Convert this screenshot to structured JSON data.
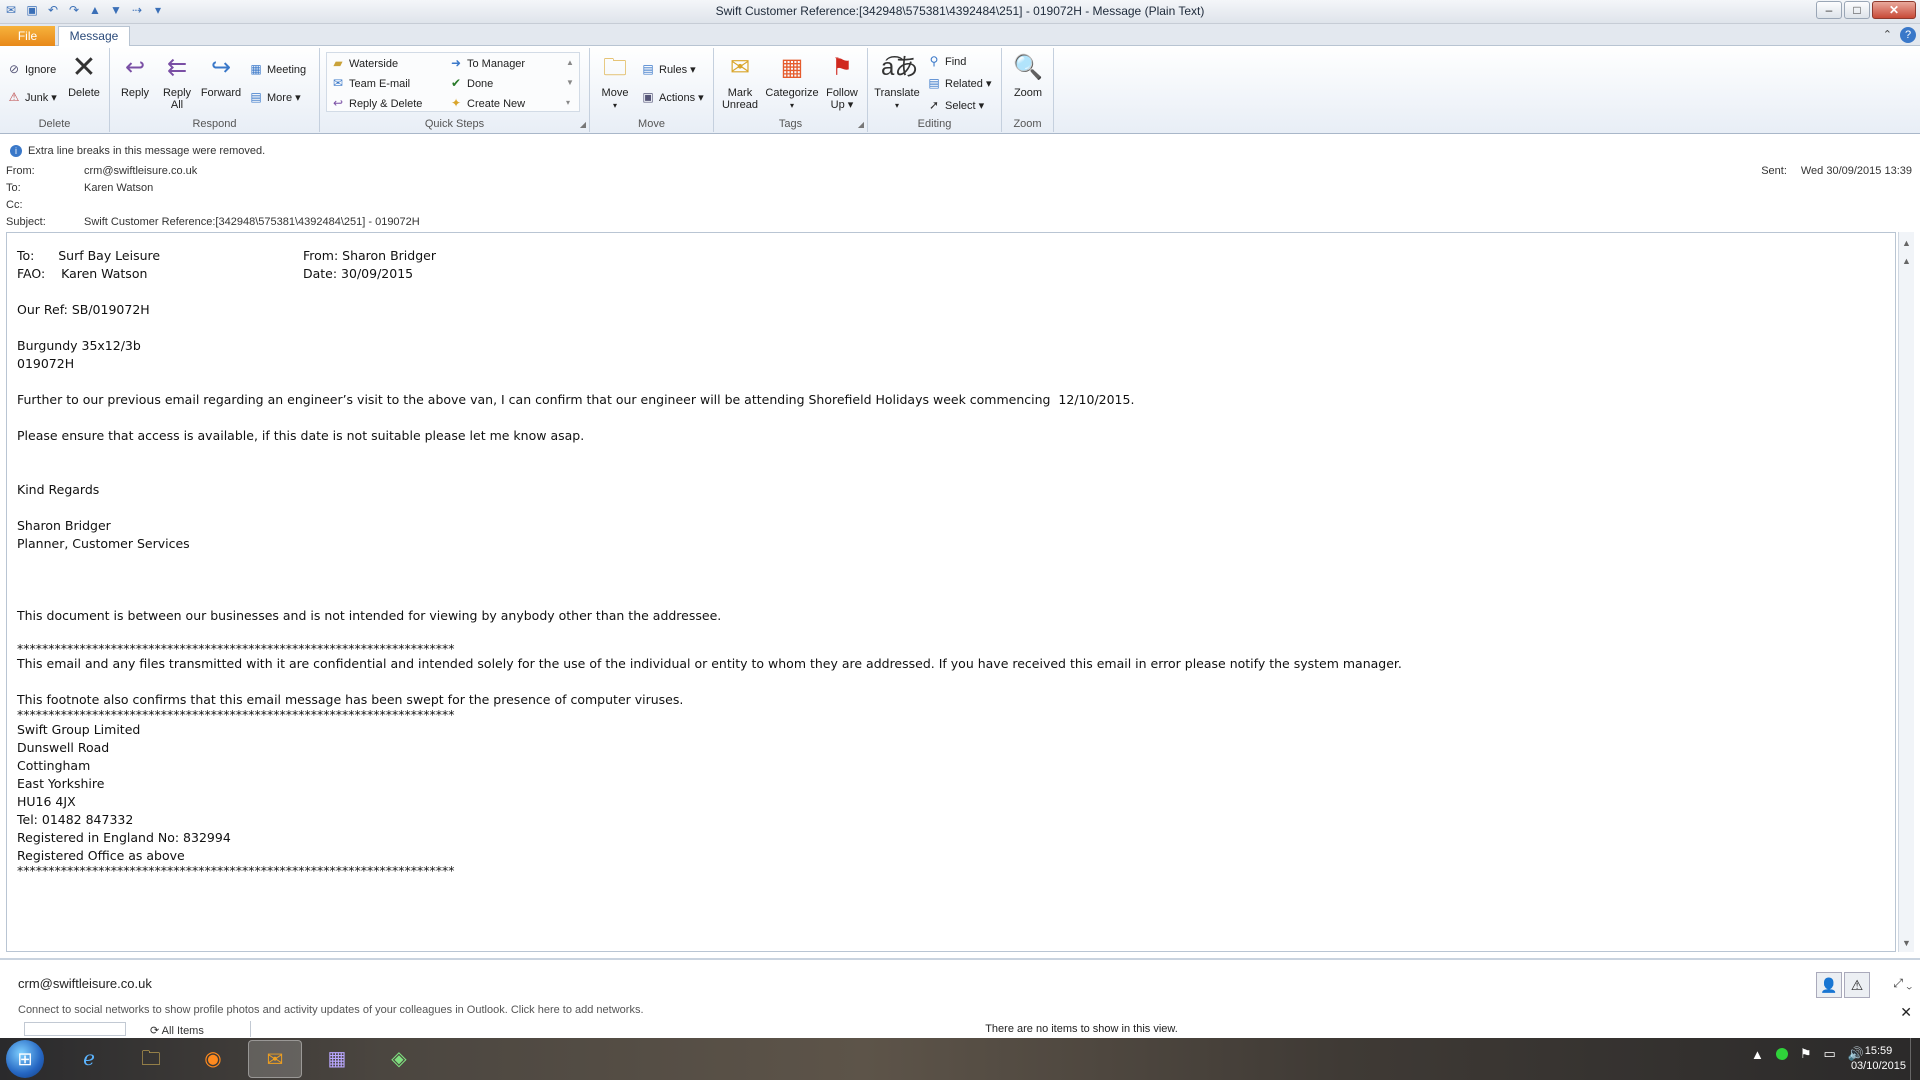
{
  "window": {
    "title": "Swift Customer Reference:[342948\\575381\\4392484\\251] - 019072H  -  Message (Plain Text)",
    "minimize": "–",
    "maximize": "□",
    "close": "✕"
  },
  "tabs": {
    "file": "File",
    "message": "Message",
    "help": "?"
  },
  "ribbon": {
    "delete": {
      "label": "Delete",
      "ignore": "Ignore",
      "junk": "Junk ▾",
      "delete": "Delete"
    },
    "respond": {
      "label": "Respond",
      "reply": "Reply",
      "reply_all_1": "Reply",
      "reply_all_2": "All",
      "forward": "Forward",
      "meeting": "Meeting",
      "more": "More ▾"
    },
    "quick_steps": {
      "label": "Quick Steps",
      "items": [
        "Waterside",
        "Team E-mail",
        "Reply & Delete",
        "To Manager",
        "Done",
        "Create New"
      ]
    },
    "move": {
      "label": "Move",
      "move": "Move",
      "rules": "Rules ▾",
      "actions": "Actions ▾"
    },
    "tags": {
      "label": "Tags",
      "mark_unread_1": "Mark",
      "mark_unread_2": "Unread",
      "categorize": "Categorize",
      "follow_up_1": "Follow",
      "follow_up_2": "Up ▾"
    },
    "editing": {
      "label": "Editing",
      "translate": "Translate",
      "find": "Find",
      "related": "Related ▾",
      "select": "Select ▾"
    },
    "zoom": {
      "label": "Zoom",
      "zoom": "Zoom"
    }
  },
  "header": {
    "info": "Extra line breaks in this message were removed.",
    "from_label": "From:",
    "from": "crm@swiftleisure.co.uk",
    "to_label": "To:",
    "to": "Karen Watson",
    "cc_label": "Cc:",
    "cc": "",
    "subject_label": "Subject:",
    "subject": "Swift Customer Reference:[342948\\575381\\4392484\\251] - 019072H",
    "sent_label": "Sent:",
    "sent": "Wed 30/09/2015 13:39"
  },
  "body": {
    "to_line": "To:      Surf Bay Leisure",
    "fao_line": "FAO:    Karen Watson",
    "from_line": "From: Sharon Bridger",
    "date_line": "Date:  30/09/2015",
    "our_ref": "Our Ref: SB/019072H",
    "van": "Burgundy 35x12/3b",
    "van_ref": "019072H",
    "para1": "Further to our previous email regarding an engineer’s visit to the above van, I can confirm that our engineer will be attending Shorefield Holidays week commencing  12/10/2015.",
    "para2": "Please ensure that access is available, if this date is not suitable please let me know asap.",
    "regards": "Kind Regards",
    "sig_name": "Sharon Bridger",
    "sig_title": "Planner, Customer Services",
    "doc_note": "This document is between our businesses and is not intended for viewing by anybody other than the addressee.",
    "stars": "**********************************************************************",
    "confidential": "This email and any files transmitted with it are confidential and intended solely for the use of the individual or entity to whom they are addressed. If you have received this email in error please notify the system manager.",
    "virus": "This footnote also confirms that this email message has been swept for the presence of computer viruses.",
    "addr1": "Swift Group Limited",
    "addr2": "Dunswell Road",
    "addr3": "Cottingham",
    "addr4": "East Yorkshire",
    "addr5": "HU16 4JX",
    "tel": "Tel: 01482 847332",
    "reg": "Registered in England No: 832994",
    "office": "Registered Office as above"
  },
  "people_pane": {
    "email": "crm@swiftleisure.co.uk",
    "connect": "Connect to social networks to show profile photos and activity updates of your colleagues in Outlook. Click here to add networks.",
    "all_items": "All Items",
    "no_items": "There are no items to show in this view."
  },
  "taskbar": {
    "time": "15:59",
    "date": "03/10/2015"
  }
}
